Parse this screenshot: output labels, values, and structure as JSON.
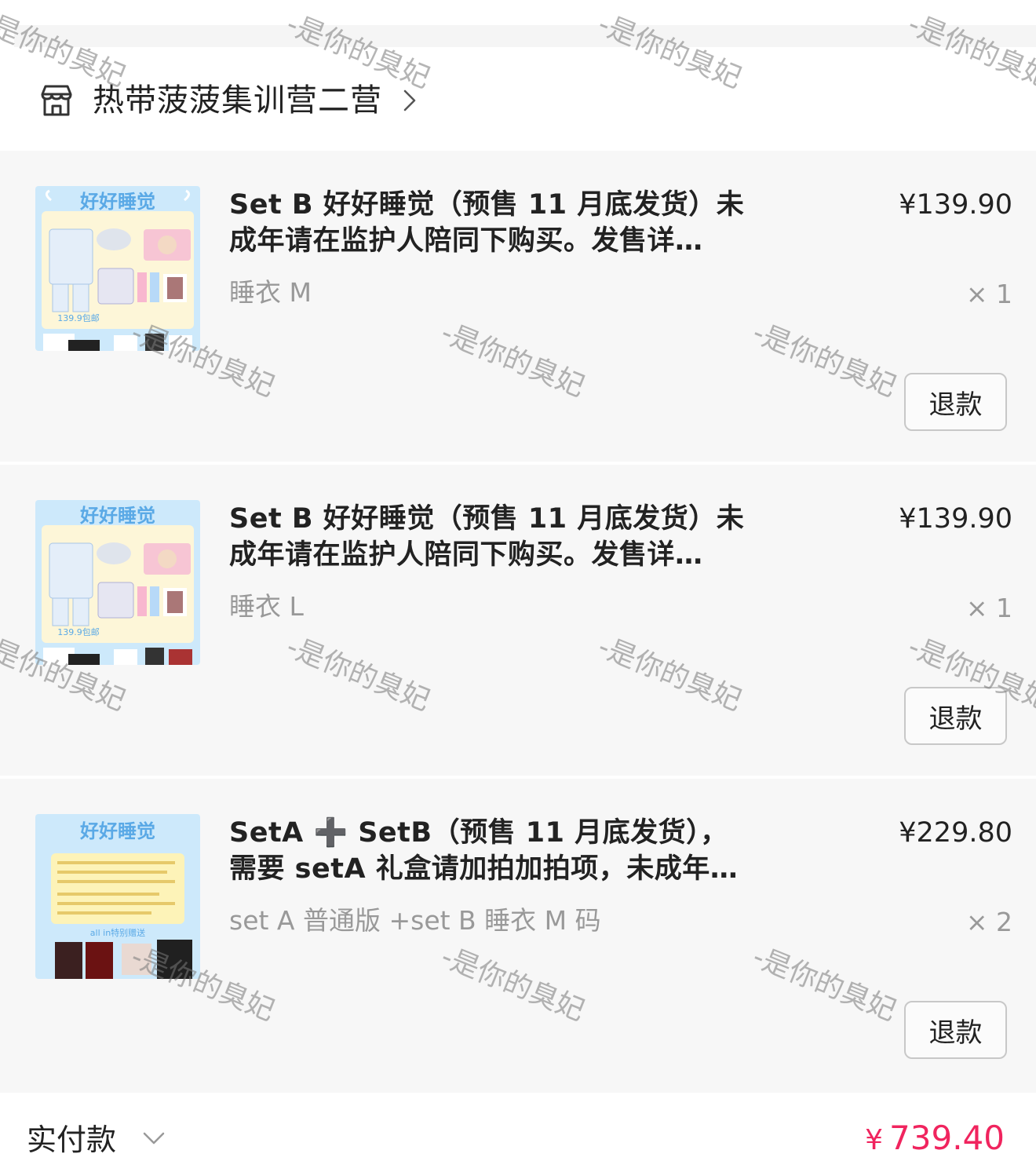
{
  "shop": {
    "name": "热带菠菠集训营二营"
  },
  "items": [
    {
      "title": "Set B 好好睡觉（预售 11 月底发货）未成年请在监护人陪同下购买。发售详…",
      "price": "¥139.90",
      "spec": "睡衣 M",
      "qty": "× 1",
      "refund_label": "退款",
      "thumb_text": "好好睡觉",
      "thumb_price": "139.9包邮"
    },
    {
      "title": "Set B 好好睡觉（预售 11 月底发货）未成年请在监护人陪同下购买。发售详…",
      "price": "¥139.90",
      "spec": "睡衣 L",
      "qty": "× 1",
      "refund_label": "退款",
      "thumb_text": "好好睡觉",
      "thumb_price": "139.9包邮"
    },
    {
      "title": "SetA ➕ SetB（预售 11 月底发货），需要 setA 礼盒请加拍加拍项，未成年…",
      "price": "¥229.80",
      "spec": "set A 普通版 +set B 睡衣 M 码",
      "qty": "× 2",
      "refund_label": "退款",
      "thumb_text": "好好睡觉",
      "thumb_price": "all in特别赠送"
    }
  ],
  "footer": {
    "label": "实付款",
    "currency": "¥",
    "amount": "739.40"
  },
  "watermark": "-是你的臭妃",
  "colors": {
    "accent": "#f0245e",
    "item_bg": "#f7f7f7",
    "muted_text": "#999999"
  },
  "icons": {
    "shop": "store-icon",
    "shop_nav": "chevron-right-icon",
    "footer_toggle": "chevron-down-icon"
  }
}
